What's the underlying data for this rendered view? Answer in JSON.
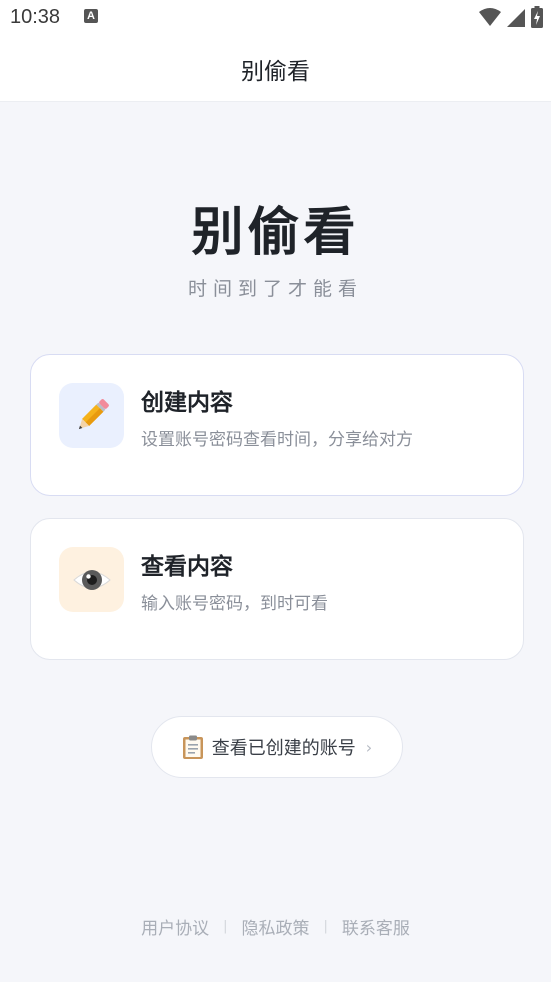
{
  "status_bar": {
    "time": "10:38",
    "notification_icon": "A",
    "icons": [
      "wifi-icon",
      "signal-icon",
      "battery-icon"
    ]
  },
  "nav": {
    "title": "别偷看"
  },
  "hero": {
    "title": "别偷看",
    "subtitle": "时间到了才能看"
  },
  "cards": {
    "create": {
      "icon": "pencil-icon",
      "title": "创建内容",
      "description": "设置账号密码查看时间，分享给对方"
    },
    "view": {
      "icon": "eye-icon",
      "title": "查看内容",
      "description": "输入账号密码，到时可看"
    }
  },
  "accounts_button": {
    "icon": "clipboard-icon",
    "label": "查看已创建的账号",
    "chevron": "›"
  },
  "footer": {
    "links": [
      "用户协议",
      "隐私政策",
      "联系客服"
    ],
    "separator": "|"
  },
  "colors": {
    "background": "#f5f6fa",
    "create_icon_bg": "#eaf0fe",
    "view_icon_bg": "#fef1e0",
    "text_primary": "#1f2329",
    "text_secondary": "#8a8f99"
  }
}
